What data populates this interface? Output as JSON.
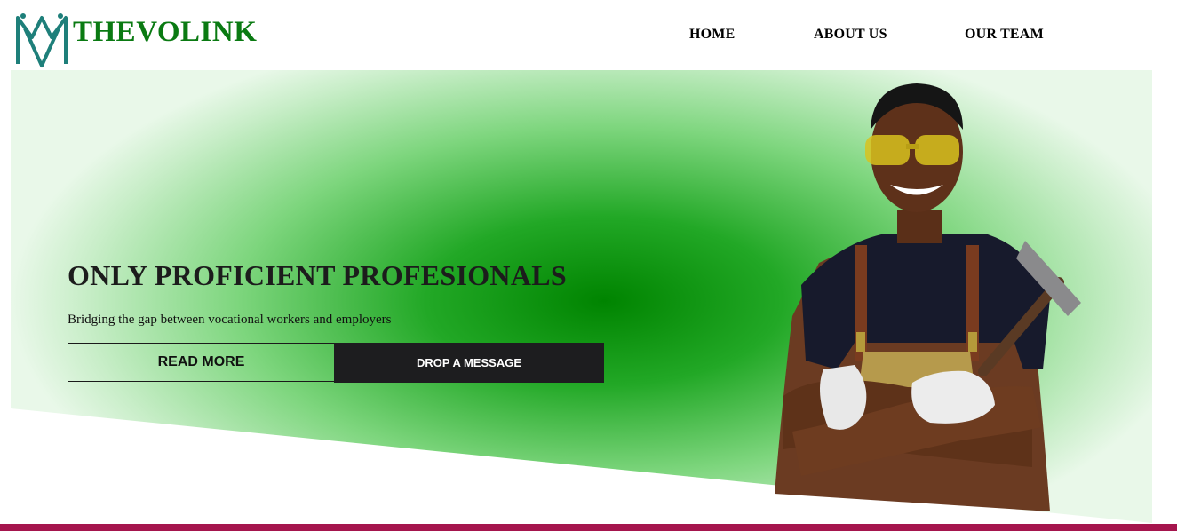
{
  "header": {
    "brand": "THEVOLINK",
    "logo_icon": "vm-monogram-logo",
    "nav": [
      "HOME",
      "ABOUT US",
      "OUR TEAM"
    ]
  },
  "hero": {
    "title": "ONLY PROFICIENT PROFESIONALS",
    "subtitle": "Bridging the gap between vocational workers and employers",
    "read_more_label": "READ MORE",
    "drop_message_label": "DROP A MESSAGE",
    "image": "worker-with-hammer"
  },
  "colors": {
    "brand_green": "#0a7a12",
    "hero_green": "#008400",
    "dark_button": "#1d1d1f",
    "bottom_bar": "#a5154d",
    "logo_teal": "#1e7f7a"
  }
}
